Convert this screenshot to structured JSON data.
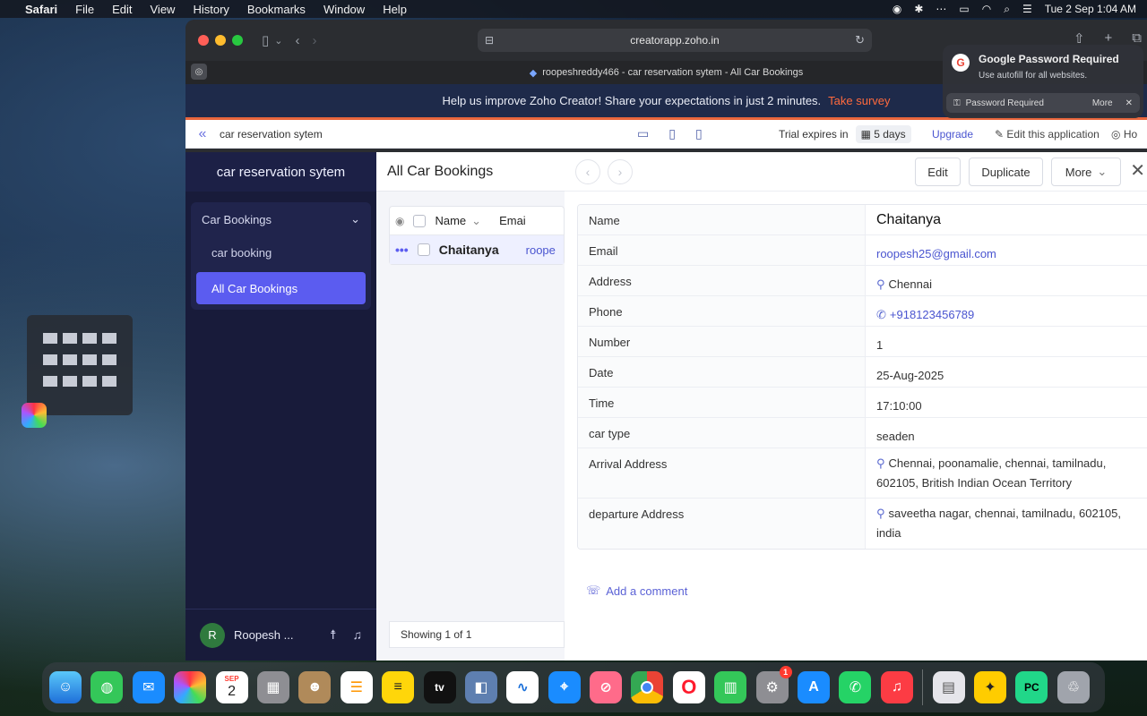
{
  "menubar": {
    "app_name": "Safari",
    "menus": [
      "File",
      "Edit",
      "View",
      "History",
      "Bookmarks",
      "Window",
      "Help"
    ],
    "clock": "Tue 2 Sep 1:04 AM"
  },
  "browser": {
    "url": "creatorapp.zoho.in",
    "tab_title": "roopeshreddy466 - car reservation sytem - All Car Bookings"
  },
  "banner": {
    "text": "Help us improve Zoho Creator! Share your expectations in just 2 minutes.",
    "link": "Take survey"
  },
  "apptop": {
    "app_name": "car reservation sytem",
    "trial_label": "Trial expires in",
    "trial_days": "5 days",
    "upgrade": "Upgrade",
    "edit_app": "Edit this application",
    "home": "Ho"
  },
  "sidebar": {
    "title": "car reservation sytem",
    "group_label": "Car Bookings",
    "items": [
      {
        "label": "car booking"
      },
      {
        "label": "All Car Bookings"
      }
    ],
    "user_name": "Roopesh ...",
    "avatar_initial": "R"
  },
  "list": {
    "title": "All Car Bookings",
    "col_name": "Name",
    "col_email": "Emai",
    "row_name": "Chaitanya",
    "row_email": "roope",
    "row_menu": "•••",
    "footer": "Showing 1 of 1"
  },
  "detail": {
    "edit": "Edit",
    "duplicate": "Duplicate",
    "more": "More",
    "fields": [
      {
        "label": "Name",
        "value": "Chaitanya"
      },
      {
        "label": "Email",
        "value": "roopesh25@gmail.com"
      },
      {
        "label": "Address",
        "value": "Chennai"
      },
      {
        "label": "Phone",
        "value": "+918123456789"
      },
      {
        "label": "Number",
        "value": "1"
      },
      {
        "label": "Date",
        "value": "25-Aug-2025"
      },
      {
        "label": "Time",
        "value": "17:10:00"
      },
      {
        "label": "car type",
        "value": "seaden"
      },
      {
        "label": "Arrival Address",
        "value": "Chennai, poonamalie, chennai, tamilnadu, 602105, British Indian Ocean Territory"
      },
      {
        "label": "departure Address",
        "value": "saveetha nagar, chennai, tamilnadu, 602105, india"
      }
    ],
    "add_comment": "Add a comment"
  },
  "notification": {
    "title": "Google Password Required",
    "subtitle": "Use autofill for all websites.",
    "bar_text": "Password Required",
    "more": "More"
  },
  "dock": {
    "calendar_month": "SEP",
    "calendar_day": "2",
    "settings_badge": "1",
    "tv_label": "tv"
  },
  "colors": {
    "accent": "#5b5cf0",
    "sidebar_bg": "#181b3a",
    "banner_accent": "#e8663d",
    "link": "#4a55d0"
  }
}
